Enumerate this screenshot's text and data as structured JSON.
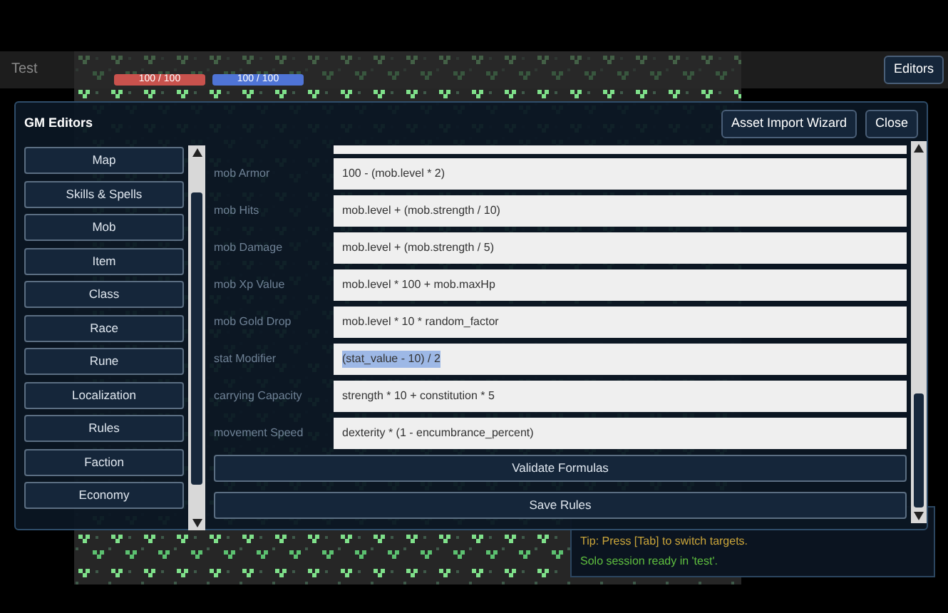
{
  "hud": {
    "status_text": "Test",
    "bars": [
      {
        "label": "100 / 100",
        "level": 1,
        "color": "#c9524d"
      },
      {
        "label": "100 / 100",
        "level": 1,
        "color": "#4f74d6"
      }
    ],
    "editors_button": "Editors"
  },
  "chat_log": [
    {
      "text": "Tip: Press [Tab] to switch targets.",
      "color": "#c9a43a"
    },
    {
      "text": "Solo session ready in 'test'.",
      "color": "#5fbf3f"
    }
  ],
  "modal": {
    "title": "GM Editors",
    "buttons": [
      "Asset Import Wizard",
      "Close"
    ],
    "editor_list": [
      {
        "label": "Map"
      },
      {
        "label": "Skills & Spells"
      },
      {
        "label": "Mob"
      },
      {
        "label": "Item"
      },
      {
        "label": "Class"
      },
      {
        "label": "Race"
      },
      {
        "label": "Rune"
      },
      {
        "label": "Localization"
      },
      {
        "label": "Rules"
      },
      {
        "label": "Faction"
      },
      {
        "label": "Economy"
      }
    ],
    "formulas": [
      {
        "label": "mob Armor",
        "value": "100 - (mob.level * 2)",
        "selected": false
      },
      {
        "label": "mob Hits",
        "value": "mob.level + (mob.strength / 10)",
        "selected": false
      },
      {
        "label": "mob Damage",
        "value": "mob.level + (mob.strength / 5)",
        "selected": false
      },
      {
        "label": "mob Xp Value",
        "value": "mob.level * 100 + mob.maxHp",
        "selected": false
      },
      {
        "label": "mob Gold Drop",
        "value": "mob.level * 10 * random_factor",
        "selected": false
      },
      {
        "label": "stat Modifier",
        "value": "(stat_value - 10) / 2",
        "selected": true
      },
      {
        "label": "carrying Capacity",
        "value": "strength * 10 + constitution * 5",
        "selected": false
      },
      {
        "label": "movement Speed",
        "value": "dexterity * (1 - encumbrance_percent)",
        "selected": false
      }
    ],
    "actions": [
      "Validate Formulas",
      "Save Rules"
    ]
  }
}
